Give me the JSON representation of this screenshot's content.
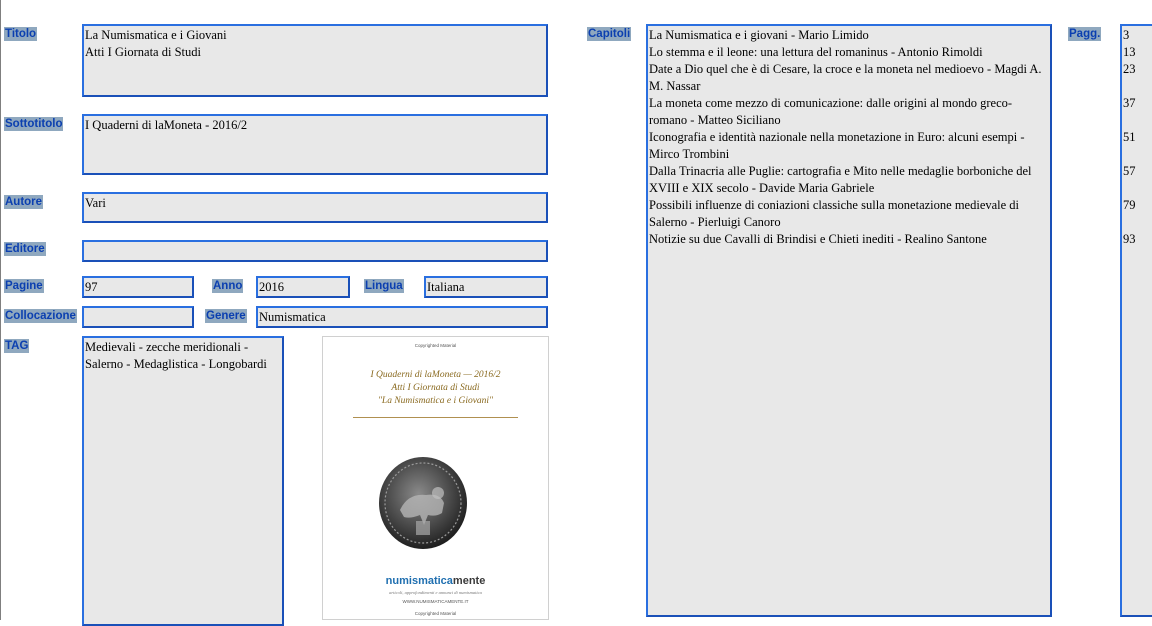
{
  "labels": {
    "titolo": "Titolo",
    "sottotitolo": "Sottotitolo",
    "autore": "Autore",
    "editore": "Editore",
    "pagine": "Pagine",
    "anno": "Anno",
    "lingua": "Lingua",
    "collocazione": "Collocazione",
    "genere": "Genere",
    "tag": "TAG",
    "capitoli": "Capitoli",
    "pagg": "Pagg."
  },
  "fields": {
    "titolo": "La Numismatica e i Giovani\nAtti I Giornata di Studi",
    "sottotitolo": "I Quaderni di laMoneta - 2016/2",
    "autore": "Vari",
    "editore": "",
    "pagine": "97",
    "anno": "2016",
    "lingua": "Italiana",
    "collocazione": "",
    "genere": "Numismatica",
    "tag": "Medievali - zecche meridionali - Salerno - Medaglistica - Longobardi"
  },
  "capitoli": [
    {
      "title": "La Numismatica e i giovani - Mario Limido",
      "page": "3"
    },
    {
      "title": "Lo stemma e il leone: una lettura del romaninus - Antonio Rimoldi",
      "page": "13"
    },
    {
      "title": "Date a Dio quel che è di Cesare, la croce e la moneta nel medioevo - Magdi A. M. Nassar",
      "page": "23"
    },
    {
      "title": "La moneta come mezzo di comunicazione: dalle origini al mondo greco-romano - Matteo Siciliano",
      "page": "37"
    },
    {
      "title": "Iconografia e identità nazionale nella monetazione in Euro: alcuni esempi - Mirco Trombini",
      "page": "51"
    },
    {
      "title": "Dalla Trinacria alle Puglie: cartografia e Mito nelle medaglie borboniche del XVIII e XIX secolo - Davide Maria Gabriele",
      "page": "57"
    },
    {
      "title": "Possibili influenze di coniazioni classiche sulla monetazione medievale di Salerno - Pierluigi Canoro",
      "page": "79"
    },
    {
      "title": "Notizie su due Cavalli di Brindisi e Chieti inediti - Realino Santone",
      "page": "93"
    }
  ],
  "cover": {
    "copyright_top": "Copyrighted Material",
    "title": "I Quaderni di laMoneta — 2016/2\nAtti I Giornata di Studi\n\"La Numismatica e i Giovani\"",
    "brand_a": "numismatica",
    "brand_b": "mente",
    "brand_sub": "articoli, approfondimenti e annunci di numismatica",
    "url": "WWW.NUMISMATICAMENTE.IT",
    "copyright_bottom": "Copyrighted Material"
  },
  "colors": {
    "label_text": "#0b3fb0",
    "label_bg": "#8fa8bf",
    "field_border": "#2a6fe0",
    "field_bg": "#e8e8e8"
  }
}
